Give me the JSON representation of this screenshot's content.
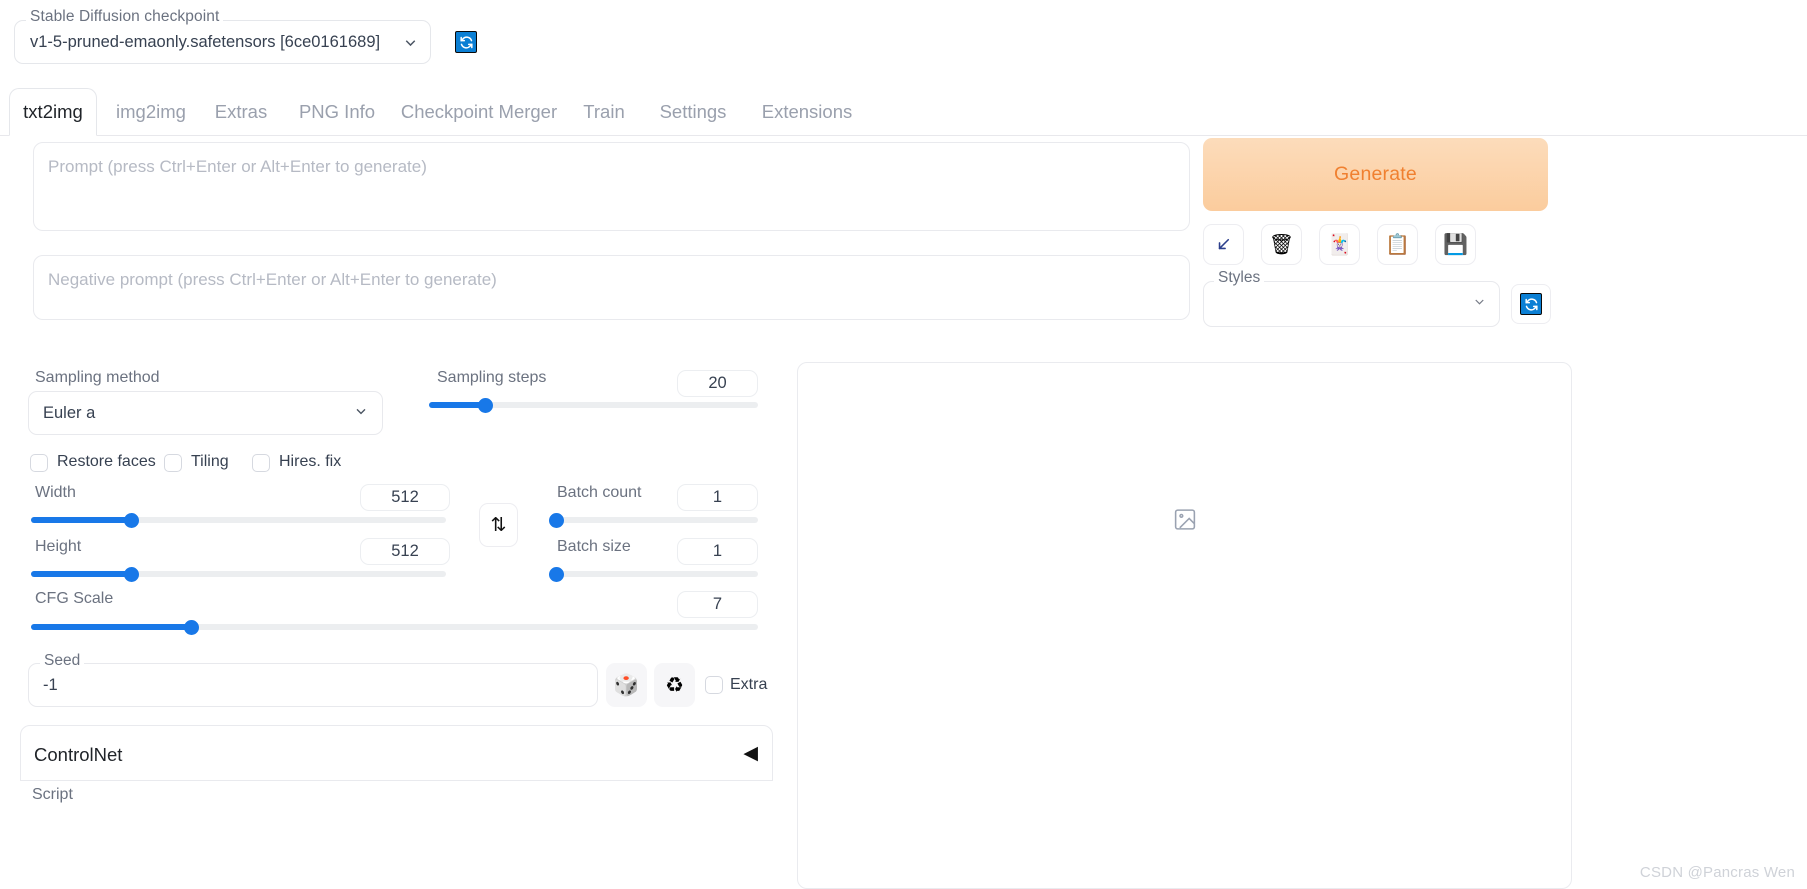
{
  "topbar": {
    "checkpoint_label": "Stable Diffusion checkpoint",
    "checkpoint_value": "v1-5-pruned-emaonly.safetensors [6ce0161689]",
    "refresh_icon": "refresh-icon",
    "caret_icon": "chevron-down-icon"
  },
  "tabs": [
    {
      "label": "txt2img",
      "active": true
    },
    {
      "label": "img2img",
      "active": false
    },
    {
      "label": "Extras",
      "active": false
    },
    {
      "label": "PNG Info",
      "active": false
    },
    {
      "label": "Checkpoint Merger",
      "active": false
    },
    {
      "label": "Train",
      "active": false
    },
    {
      "label": "Settings",
      "active": false
    },
    {
      "label": "Extensions",
      "active": false
    }
  ],
  "prompts": {
    "positive_placeholder": "Prompt (press Ctrl+Enter or Alt+Enter to generate)",
    "positive_value": "",
    "negative_placeholder": "Negative prompt (press Ctrl+Enter or Alt+Enter to generate)",
    "negative_value": ""
  },
  "generate": {
    "label": "Generate",
    "accent_color": "#f08030",
    "bg_color": "#fbcc9d"
  },
  "toolbuttons": [
    {
      "name": "restore-progress-arrow-icon",
      "glyph": "↙"
    },
    {
      "name": "clear-prompt-trash-icon",
      "glyph": "🗑"
    },
    {
      "name": "read-generation-params-icon",
      "glyph": "🃏"
    },
    {
      "name": "apply-style-clipboard-icon",
      "glyph": "📋"
    },
    {
      "name": "save-style-floppy-icon",
      "glyph": "💾"
    }
  ],
  "styles": {
    "label": "Styles",
    "value": "",
    "caret_icon": "chevron-down-icon",
    "refresh_icon": "refresh-icon"
  },
  "settings": {
    "sampling_method": {
      "label": "Sampling method",
      "value": "Euler a"
    },
    "sampling_steps": {
      "label": "Sampling steps",
      "value": "20",
      "percent": 17
    },
    "checkboxes": [
      {
        "label": "Restore faces",
        "checked": false
      },
      {
        "label": "Tiling",
        "checked": false
      },
      {
        "label": "Hires. fix",
        "checked": false
      }
    ],
    "width": {
      "label": "Width",
      "value": "512",
      "percent": 24
    },
    "height": {
      "label": "Height",
      "value": "512",
      "percent": 24
    },
    "cfg_scale": {
      "label": "CFG Scale",
      "value": "7",
      "percent": 22
    },
    "batch_count": {
      "label": "Batch count",
      "value": "1",
      "percent": 0
    },
    "batch_size": {
      "label": "Batch size",
      "value": "1",
      "percent": 0
    },
    "swap_icon": "swap-dimensions-icon",
    "seed": {
      "label": "Seed",
      "value": "-1",
      "random_icon": "dice-icon",
      "reuse_icon": "recycle-icon",
      "extra_label": "Extra",
      "extra_checked": false
    }
  },
  "accordion": {
    "title": "ControlNet",
    "arrow_icon": "triangle-left-icon",
    "script_label": "Script"
  },
  "output": {
    "placeholder_icon": "image-placeholder-icon"
  },
  "watermark": {
    "text": "CSDN @Pancras Wen"
  }
}
